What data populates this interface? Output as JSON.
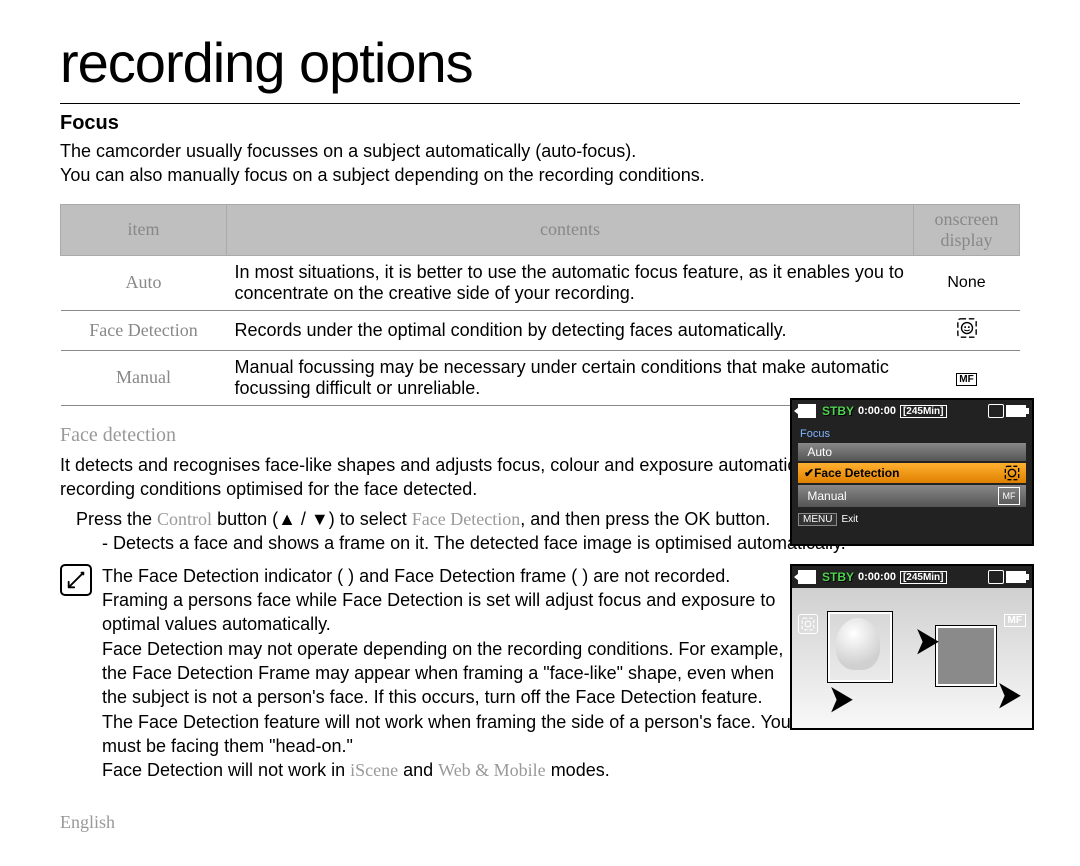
{
  "title": "recording options",
  "focus": {
    "heading": "Focus",
    "para1": "The camcorder usually focusses on a subject automatically (auto-focus).",
    "para2": "You can also manually focus on a subject depending on the recording conditions."
  },
  "table": {
    "headers": {
      "item": "item",
      "contents": "contents",
      "osd": "onscreen display"
    },
    "rows": [
      {
        "item": "Auto",
        "contents": "In most situations, it is better to use the automatic focus feature, as it enables you to concentrate on the creative side of your recording.",
        "osd": "None"
      },
      {
        "item": "Face Detection",
        "contents": "Records under the optimal condition by detecting faces automatically.",
        "osd": "face-detect-icon"
      },
      {
        "item": "Manual",
        "contents": "Manual focussing may be necessary under certain conditions that make automatic focussing difficult or unreliable.",
        "osd": "MF"
      }
    ]
  },
  "face_section": {
    "heading": "Face detection",
    "para": "It detects and recognises face-like shapes and adjusts focus, colour and exposure automatically. Also, it adjusts recording conditions optimised for the face detected.",
    "step_a": "Press the ",
    "step_b": "Control",
    "step_c": " button (▲ / ▼) to select ",
    "step_c2": "Face Detection",
    "step_d": ", and then press the OK button.",
    "bullet": "- Detects a face and shows a frame on it. The detected face image is optimised automatically."
  },
  "notes": [
    "The Face Detection indicator (  ) and Face Detection frame (  ) are not recorded.",
    "Framing a persons face while Face Detection is set will adjust focus and exposure to optimal values automatically.",
    "Face Detection may not operate depending on the recording conditions. For example, the Face Detection Frame may appear when framing a \"face-like\" shape, even when the subject is not a person's face. If this occurs, turn off the Face Detection feature.",
    "The Face Detection feature will not work when framing the side of a person's face. You must be facing them \"head-on.\"",
    "Face Detection will not work in iScene and Web & Mobile modes."
  ],
  "note_inline": {
    "iscene": "iScene",
    "web": "Web & Mobile"
  },
  "lcd": {
    "stby": "STBY",
    "time": "0:00:00",
    "remain": "[245Min]",
    "menu_title": "Focus",
    "items": [
      {
        "label": "Auto",
        "checked": false,
        "icon": ""
      },
      {
        "label": "Face Detection",
        "checked": true,
        "icon": "face"
      },
      {
        "label": "Manual",
        "checked": false,
        "icon": "mf"
      }
    ],
    "menu_btn": "MENU",
    "exit": "Exit"
  },
  "footer": "English"
}
